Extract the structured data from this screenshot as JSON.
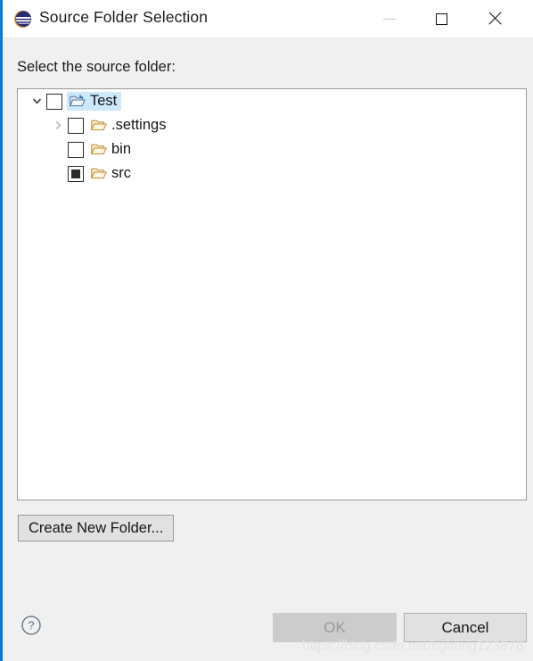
{
  "window": {
    "title": "Source Folder Selection",
    "icon": "eclipse-icon",
    "controls": {
      "minimize": "minimize-icon",
      "maximize": "maximize-icon",
      "close": "close-icon"
    }
  },
  "body": {
    "prompt_label": "Select the source folder:"
  },
  "tree": {
    "nodes": [
      {
        "label": "Test",
        "indent": 0,
        "twisty": "expanded",
        "checked": false,
        "selected": true,
        "icon": "project-folder-icon"
      },
      {
        "label": ".settings",
        "indent": 1,
        "twisty": "collapsed",
        "checked": false,
        "selected": false,
        "icon": "folder-icon"
      },
      {
        "label": "bin",
        "indent": 1,
        "twisty": "none",
        "checked": false,
        "selected": false,
        "icon": "folder-icon"
      },
      {
        "label": "src",
        "indent": 1,
        "twisty": "none",
        "checked": true,
        "selected": false,
        "icon": "folder-icon"
      }
    ]
  },
  "buttons": {
    "create_new_folder": "Create New Folder...",
    "ok": "OK",
    "ok_enabled": false,
    "cancel": "Cancel",
    "help": "help-icon"
  },
  "watermark": {
    "text": "https://blog.csdn.net/fighting123678"
  },
  "colors": {
    "dialog_background": "#f0f0f0",
    "titlebar_background": "#ffffff",
    "panel_background": "#ffffff",
    "panel_border": "#9a9a9a",
    "selection_highlight": "#cde8fb",
    "accent_border": "#0a7bd4",
    "button_face": "#e1e1e1",
    "disabled_button_face": "#cccccc",
    "disabled_text": "#9a9a9a",
    "folder_icon": "#e8a33d",
    "project_folder_icon": "#4a76a8"
  }
}
